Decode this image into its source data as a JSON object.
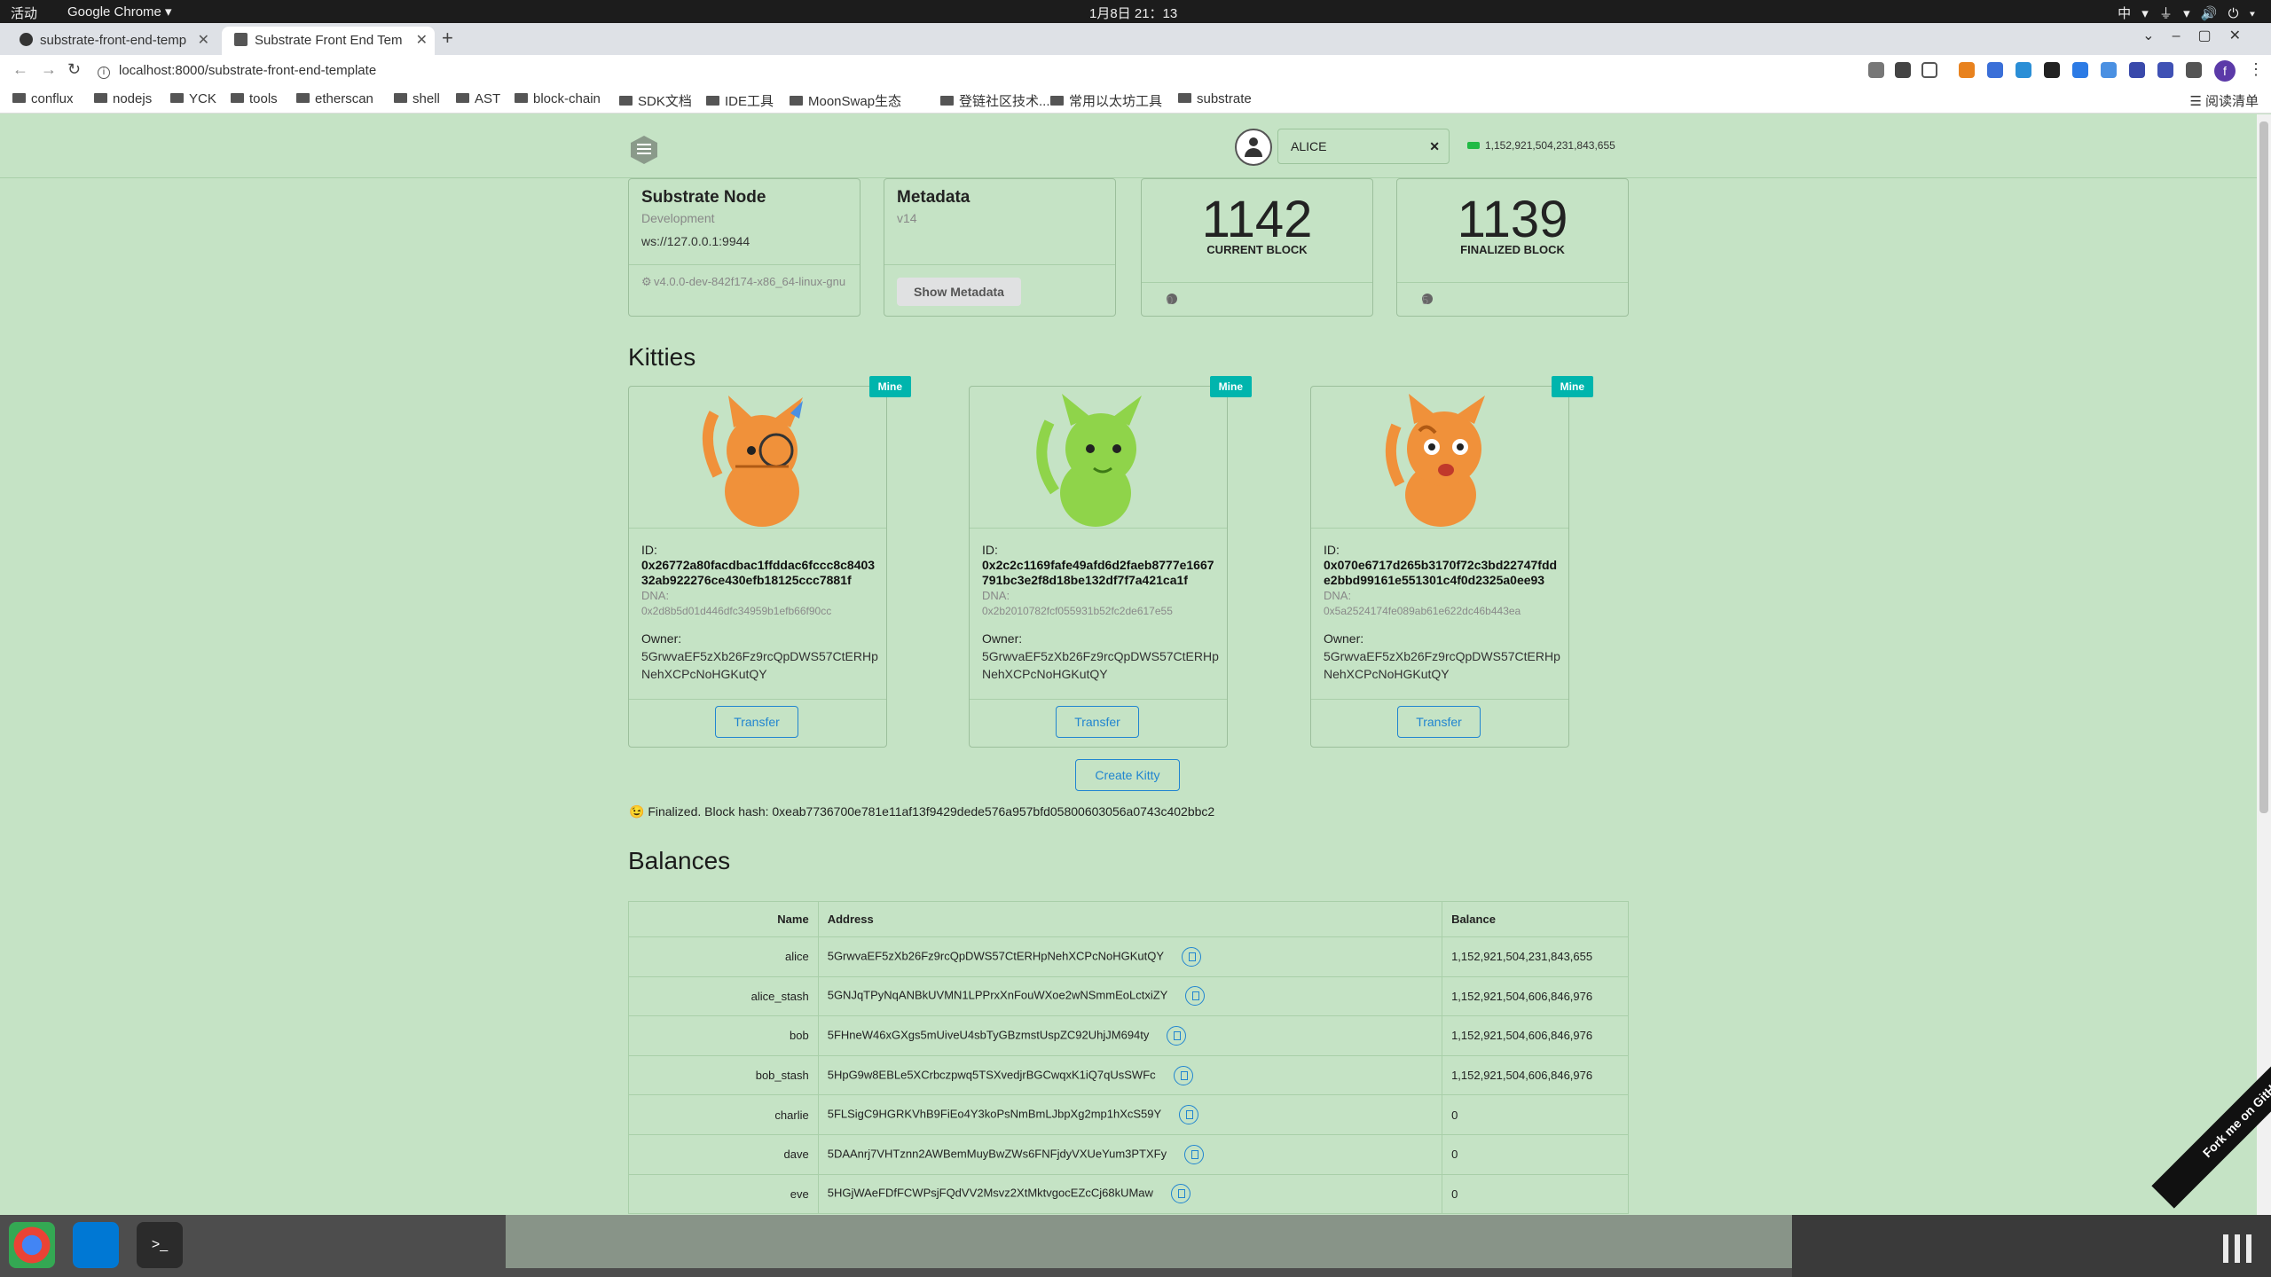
{
  "system": {
    "activities": "活动",
    "app_menu": "Google Chrome ▾",
    "clock": "1月8日  21：13",
    "tray": "中 ▾   ⏚ ▾  🔊  ⏻ ▾"
  },
  "browser": {
    "tabs": [
      {
        "label": "substrate-front-end-temp"
      },
      {
        "label": "Substrate Front End Tem"
      }
    ],
    "url": "localhost:8000/substrate-front-end-template",
    "bookmarks": [
      "conflux",
      "nodejs",
      "YCK",
      "tools",
      "etherscan",
      "shell",
      "AST",
      "block-chain",
      "SDK文档",
      "IDE工具",
      "MoonSwap生态",
      "登链社区技术...",
      "常用以太坊工具",
      "substrate"
    ],
    "reading_list": "阅读清单"
  },
  "header": {
    "account": "ALICE",
    "balance": "1,152,921,504,231,843,655"
  },
  "node": {
    "title": "Substrate Node",
    "meta": "Development",
    "endpoint": "ws://127.0.0.1:9944",
    "version": "v4.0.0-dev-842f174-x86_64-linux-gnu"
  },
  "metadata": {
    "title": "Metadata",
    "version": "v14",
    "button": "Show Metadata"
  },
  "blocks": {
    "current": {
      "number": "1142",
      "label": "CURRENT BLOCK",
      "timer": "0"
    },
    "finalized": {
      "number": "1139",
      "label": "FINALIZED BLOCK",
      "timer": "5"
    }
  },
  "kitties": {
    "title": "Kitties",
    "items": [
      {
        "badge": "Mine",
        "id_label": "ID:",
        "id": "0x26772a80facdbac1ffddac6fccc8c840332ab922276ce430efb18125ccc7881f",
        "dna_label": "DNA:",
        "dna": "0x2d8b5d01d446dfc34959b1efb66f90cc",
        "owner_label": "Owner:",
        "owner": "5GrwvaEF5zXb26Fz9rcQpDWS57CtERHpNehXCPcNoHGKutQY",
        "button": "Transfer",
        "color": "#f0913a"
      },
      {
        "badge": "Mine",
        "id_label": "ID:",
        "id": "0x2c2c1169fafe49afd6d2faeb8777e1667791bc3e2f8d18be132df7f7a421ca1f",
        "dna_label": "DNA:",
        "dna": "0x2b2010782fcf055931b52fc2de617e55",
        "owner_label": "Owner:",
        "owner": "5GrwvaEF5zXb26Fz9rcQpDWS57CtERHpNehXCPcNoHGKutQY",
        "button": "Transfer",
        "color": "#8fd44a"
      },
      {
        "badge": "Mine",
        "id_label": "ID:",
        "id": "0x070e6717d265b3170f72c3bd22747fdde2bbd99161e551301c4f0d2325a0ee93",
        "dna_label": "DNA:",
        "dna": "0x5a2524174fe089ab61e622dc46b443ea",
        "owner_label": "Owner:",
        "owner": "5GrwvaEF5zXb26Fz9rcQpDWS57CtERHpNehXCPcNoHGKutQY",
        "button": "Transfer",
        "color": "#f0913a"
      }
    ],
    "create_button": "Create Kitty",
    "status": "😉 Finalized. Block hash: 0xeab7736700e781e11af13f9429dede576a957bfd05800603056a0743c402bbc2"
  },
  "balances": {
    "title": "Balances",
    "headers": {
      "name": "Name",
      "address": "Address",
      "balance": "Balance"
    },
    "rows": [
      {
        "name": "alice",
        "address": "5GrwvaEF5zXb26Fz9rcQpDWS57CtERHpNehXCPcNoHGKutQY",
        "balance": "1,152,921,504,231,843,655"
      },
      {
        "name": "alice_stash",
        "address": "5GNJqTPyNqANBkUVMN1LPPrxXnFouWXoe2wNSmmEoLctxiZY",
        "balance": "1,152,921,504,606,846,976"
      },
      {
        "name": "bob",
        "address": "5FHneW46xGXgs5mUiveU4sbTyGBzmstUspZC92UhjJM694ty",
        "balance": "1,152,921,504,606,846,976"
      },
      {
        "name": "bob_stash",
        "address": "5HpG9w8EBLe5XCrbczpwq5TSXvedjrBGCwqxK1iQ7qUsSWFc",
        "balance": "1,152,921,504,606,846,976"
      },
      {
        "name": "charlie",
        "address": "5FLSigC9HGRKVhB9FiEo4Y3koPsNmBmLJbpXg2mp1hXcS59Y",
        "balance": "0"
      },
      {
        "name": "dave",
        "address": "5DAAnrj7VHTznn2AWBemMuyBwZWs6FNFjdyVXUeYum3PTXFy",
        "balance": "0"
      },
      {
        "name": "eve",
        "address": "5HGjWAeFDfFCWPsjFQdVV2Msvz2XtMktvgocEZcCj68kUMaw",
        "balance": "0"
      }
    ]
  },
  "fork": "Fork me on GitHub"
}
